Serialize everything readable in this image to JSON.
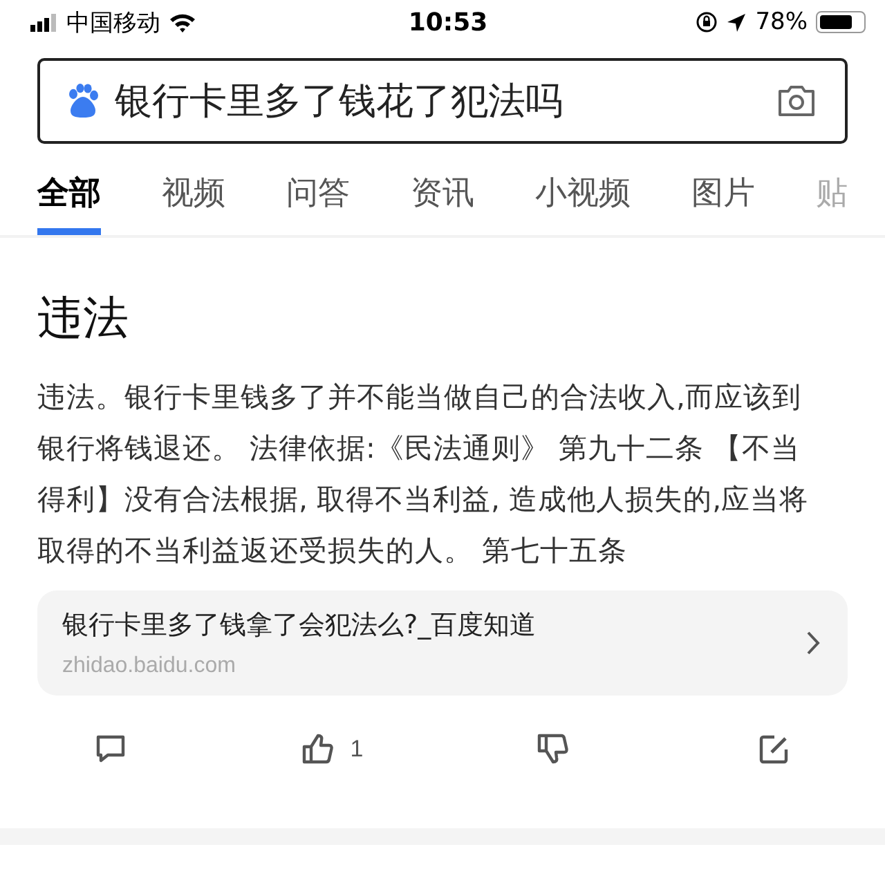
{
  "status_bar": {
    "carrier": "中国移动",
    "time": "10:53",
    "battery": "78%"
  },
  "search": {
    "value": "银行卡里多了钱花了犯法吗"
  },
  "tabs": [
    {
      "label": "全部",
      "selected": true
    },
    {
      "label": "视频",
      "selected": false
    },
    {
      "label": "问答",
      "selected": false
    },
    {
      "label": "资讯",
      "selected": false
    },
    {
      "label": "小视频",
      "selected": false
    },
    {
      "label": "图片",
      "selected": false
    },
    {
      "label": "贴",
      "selected": false
    }
  ],
  "result": {
    "title": "违法",
    "text": "违法。银行卡里钱多了并不能当做自己的合法收入,而应该到银行将钱退还。 法律依据:《民法通则》 第九十二条 【不当得利】没有合法根据, 取得不当利益, 造成他人损失的,应当将取得的不当利益返还受损失的人。 第七十五条",
    "source": {
      "title": "银行卡里多了钱拿了会犯法么?_百度知道",
      "url": "zhidao.baidu.com"
    },
    "actions": [
      {
        "kind": "comment"
      },
      {
        "kind": "like",
        "count": "1"
      },
      {
        "kind": "dislike"
      },
      {
        "kind": "edit"
      }
    ]
  }
}
